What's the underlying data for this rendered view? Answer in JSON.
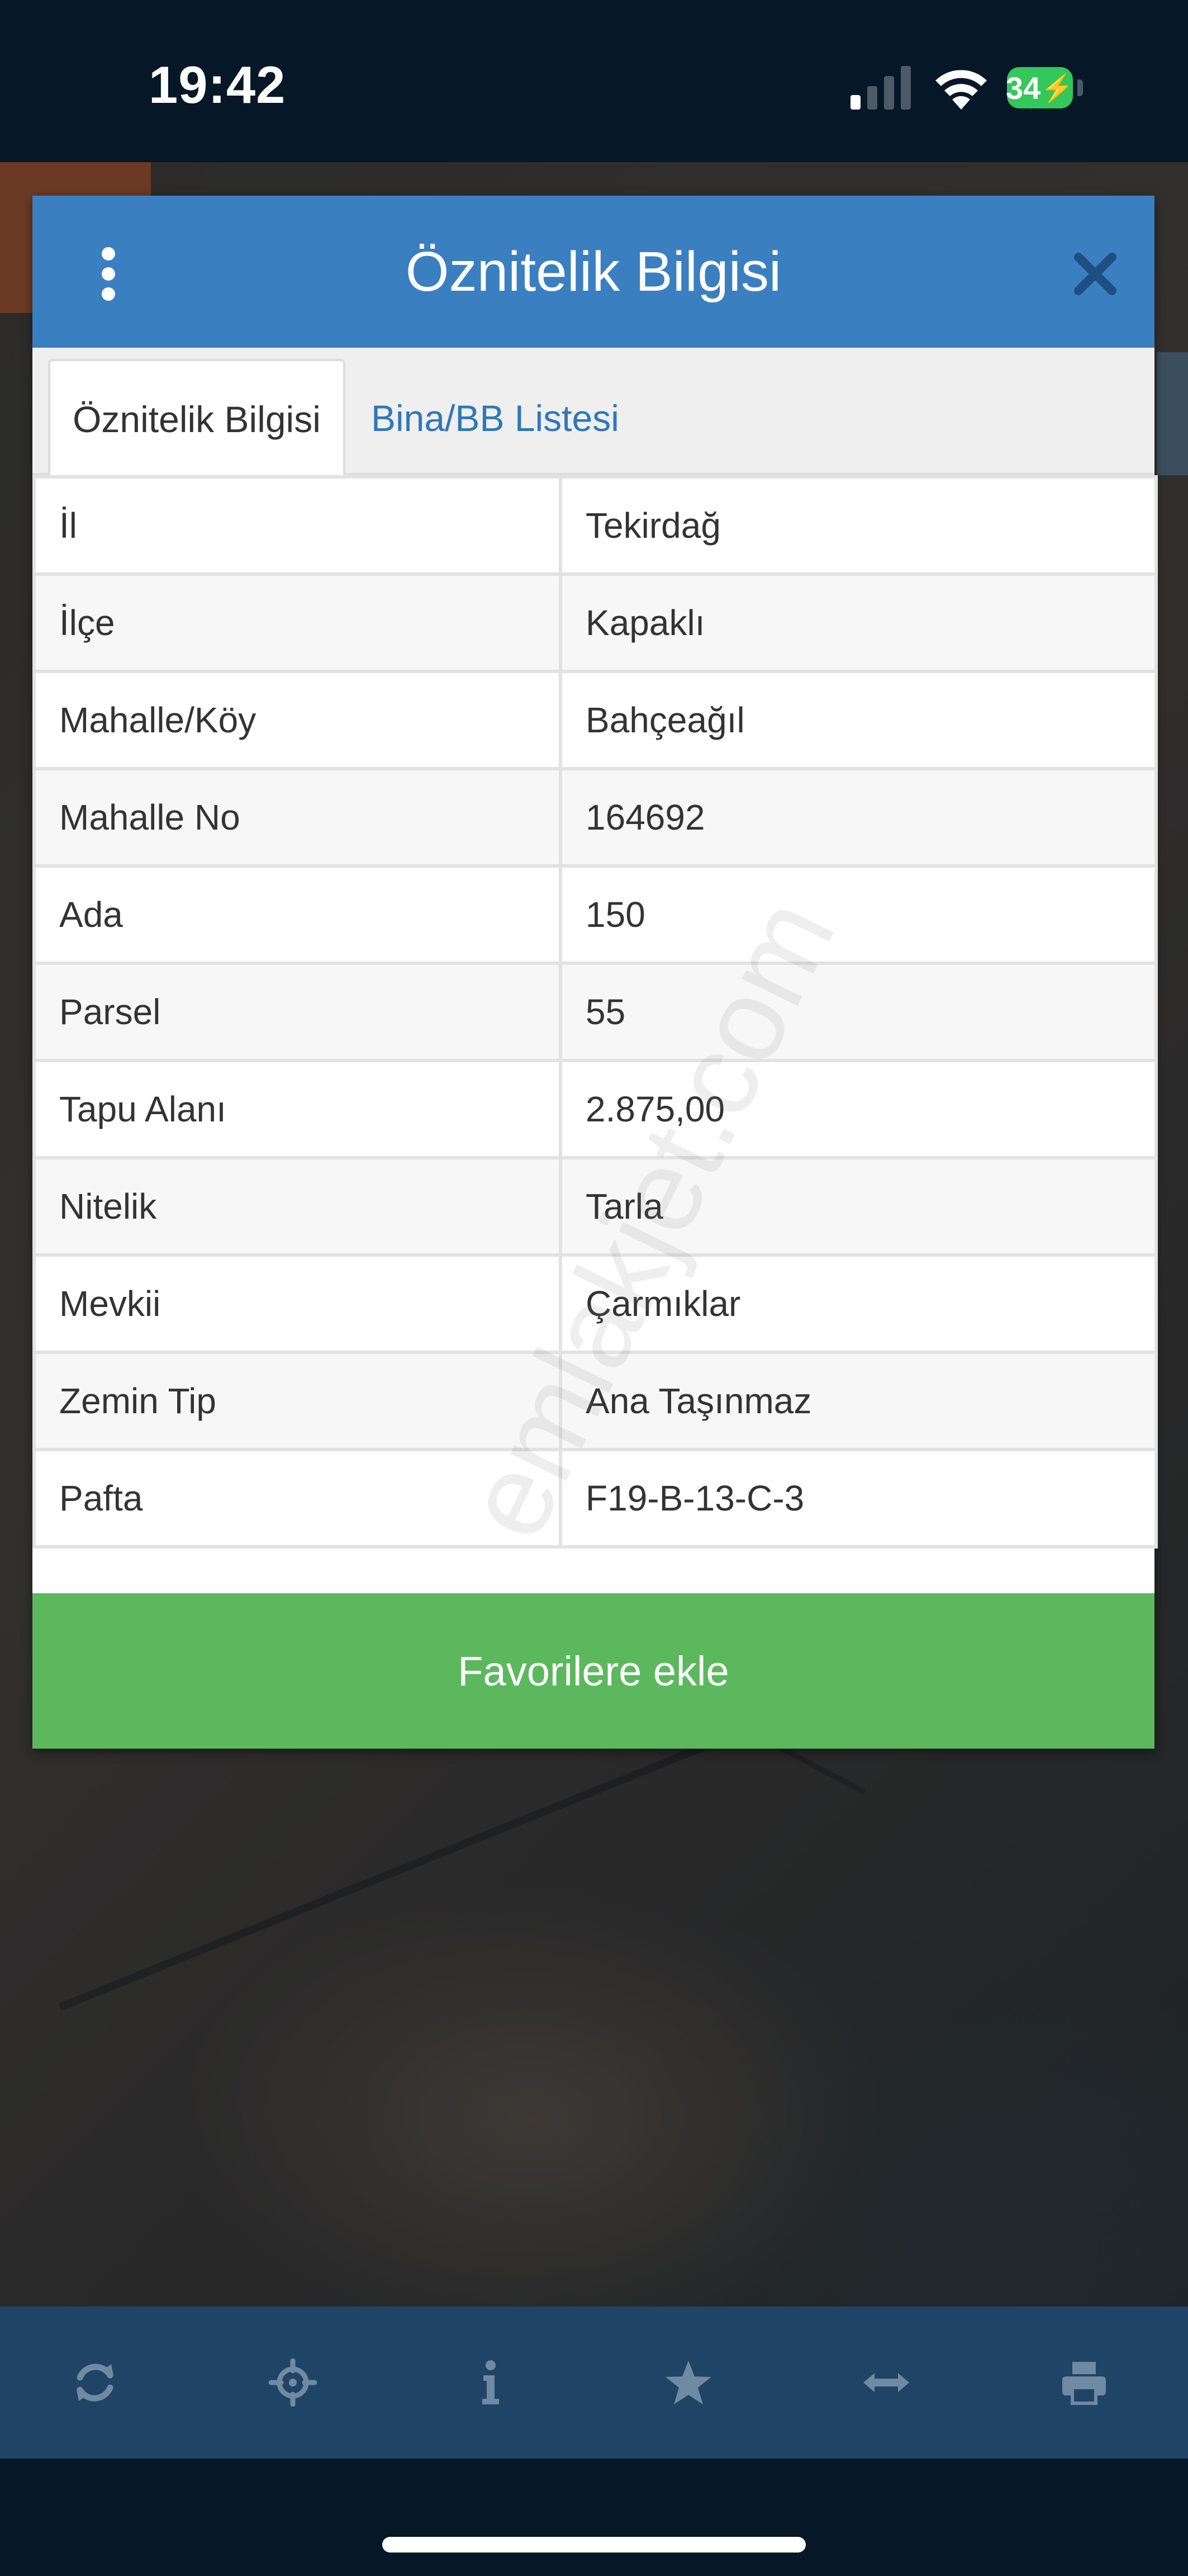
{
  "status_bar": {
    "time": "19:42",
    "battery": "34"
  },
  "modal": {
    "title": "Öznitelik Bilgisi",
    "menu_icon": "vertical-dots-icon",
    "close_icon": "close-x-icon",
    "tabs": [
      {
        "label": "Öznitelik Bilgisi",
        "active": true
      },
      {
        "label": "Bina/BB Listesi",
        "active": false
      }
    ],
    "rows": [
      {
        "label": "İl",
        "value": "Tekirdağ"
      },
      {
        "label": "İlçe",
        "value": "Kapaklı"
      },
      {
        "label": "Mahalle/Köy",
        "value": "Bahçeağıl"
      },
      {
        "label": "Mahalle No",
        "value": "164692"
      },
      {
        "label": "Ada",
        "value": "150"
      },
      {
        "label": "Parsel",
        "value": "55"
      },
      {
        "label": "Tapu Alanı",
        "value": "2.875,00"
      },
      {
        "label": "Nitelik",
        "value": "Tarla"
      },
      {
        "label": "Mevkii",
        "value": "Çarmıklar"
      },
      {
        "label": "Zemin Tip",
        "value": "Ana Taşınmaz"
      },
      {
        "label": "Pafta",
        "value": "F19-B-13-C-3"
      }
    ],
    "watermark": "emlakjet.com",
    "favorite_button": "Favorilere ekle"
  },
  "toolbar": {
    "icons": [
      "refresh-icon",
      "crosshair-icon",
      "info-icon",
      "star-icon",
      "arrows-horizontal-icon",
      "print-icon"
    ],
    "icon_color": "#6f8aa3"
  },
  "colors": {
    "header_blue": "#3a7fc0",
    "tab_link_blue": "#2f77b8",
    "favorite_green": "#5cb85c",
    "toolbar_bg": "#1f4466",
    "battery_green": "#34c759"
  }
}
